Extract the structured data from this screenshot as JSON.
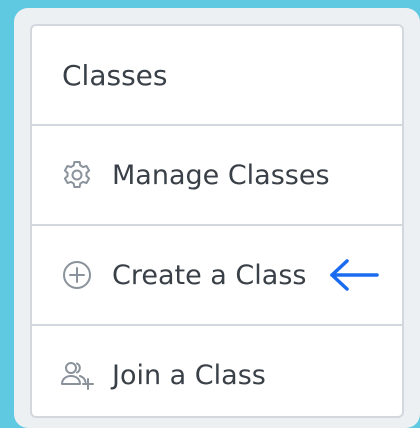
{
  "menu": {
    "heading": "Classes",
    "items": [
      {
        "label": "Manage Classes",
        "icon": "gear-icon"
      },
      {
        "label": "Create a Class",
        "icon": "plus-circle-icon"
      },
      {
        "label": "Join a Class",
        "icon": "user-group-add-icon"
      }
    ]
  },
  "annotation": {
    "icon": "arrow-left-icon",
    "color": "#1a6bf0"
  },
  "colors": {
    "background": "#5fc9e2",
    "panel": "#edf0f3",
    "border": "#d3d8de",
    "text": "#3a4047",
    "icon": "#8a929b"
  }
}
